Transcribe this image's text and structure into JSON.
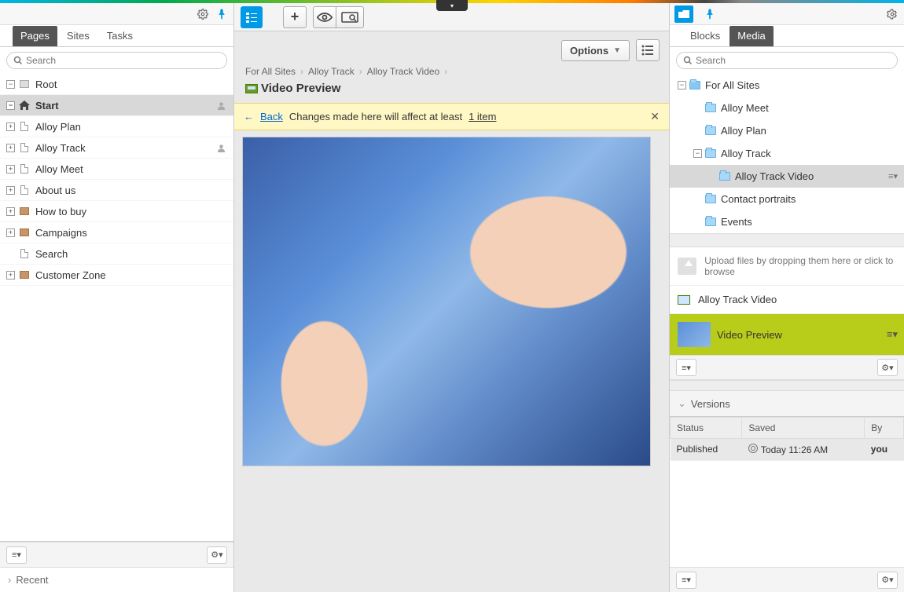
{
  "leftPanel": {
    "tabs": [
      "Pages",
      "Sites",
      "Tasks"
    ],
    "activeTab": 0,
    "searchPlaceholder": "Search",
    "root": "Root",
    "tree": [
      {
        "label": "Start",
        "icon": "home",
        "expandable": "-",
        "level": 1,
        "selected": true,
        "userBadge": true
      },
      {
        "label": "Alloy Plan",
        "icon": "page",
        "expandable": "+",
        "level": 2
      },
      {
        "label": "Alloy Track",
        "icon": "page",
        "expandable": "+",
        "level": 2,
        "userBadge": true
      },
      {
        "label": "Alloy Meet",
        "icon": "page",
        "expandable": "+",
        "level": 2
      },
      {
        "label": "About us",
        "icon": "page",
        "expandable": "+",
        "level": 2
      },
      {
        "label": "How to buy",
        "icon": "container",
        "expandable": "+",
        "level": 2
      },
      {
        "label": "Campaigns",
        "icon": "container",
        "expandable": "+",
        "level": 2
      },
      {
        "label": "Search",
        "icon": "page",
        "expandable": "",
        "level": 2
      },
      {
        "label": "Customer Zone",
        "icon": "container",
        "expandable": "+",
        "level": 1
      }
    ],
    "recent": "Recent"
  },
  "center": {
    "optionsLabel": "Options",
    "breadcrumbs": [
      "For All Sites",
      "Alloy Track",
      "Alloy Track Video"
    ],
    "title": "Video Preview",
    "warning": {
      "back": "Back",
      "text": "Changes made here will affect at least",
      "link": "1 item"
    }
  },
  "rightPanel": {
    "tabs": [
      "Blocks",
      "Media"
    ],
    "activeTab": 1,
    "searchPlaceholder": "Search",
    "tree": [
      {
        "label": "For All Sites",
        "expandable": "-",
        "level": 0,
        "site": true
      },
      {
        "label": "Alloy Meet",
        "level": 1
      },
      {
        "label": "Alloy Plan",
        "level": 1
      },
      {
        "label": "Alloy Track",
        "expandable": "-",
        "level": 1
      },
      {
        "label": "Alloy Track Video",
        "level": 2,
        "selected": true,
        "menu": true
      },
      {
        "label": "Contact portraits",
        "level": 1
      },
      {
        "label": "Events",
        "level": 1
      }
    ],
    "uploadHint": "Upload files by dropping them here or click to browse",
    "folderAsset": "Alloy Track Video",
    "selectedAsset": "Video Preview",
    "versionsHeader": "Versions",
    "columns": [
      "Status",
      "Saved",
      "By"
    ],
    "rows": [
      {
        "status": "Published",
        "saved": "Today 11:26 AM",
        "by": "you"
      }
    ]
  }
}
